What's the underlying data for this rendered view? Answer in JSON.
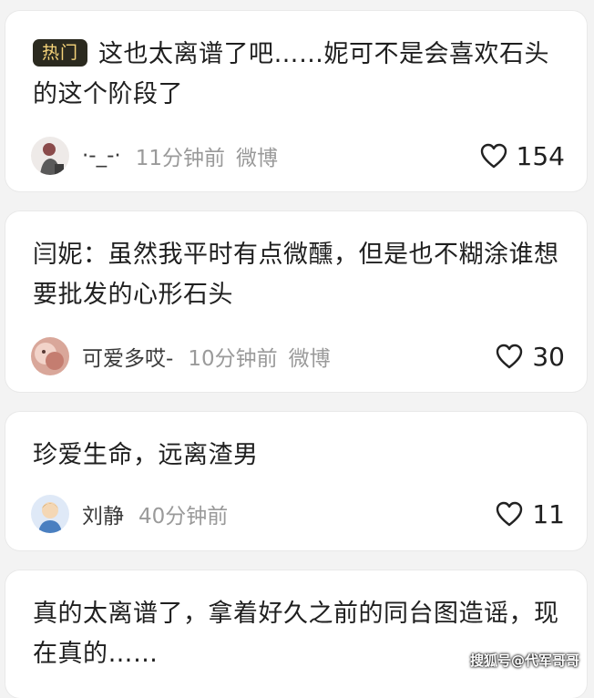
{
  "comments": [
    {
      "badge": "热门",
      "text": "这也太离谱了吧……妮可不是会喜欢石头的这个阶段了",
      "username": "·-_-·",
      "time": "11分钟前",
      "source": "微博",
      "likes": "154"
    },
    {
      "text": "闫妮：虽然我平时有点微醺，但是也不糊涂谁想要批发的心形石头",
      "username": "可爱多哎-",
      "time": "10分钟前",
      "source": "微博",
      "likes": "30"
    },
    {
      "text": "珍爱生命，远离渣男",
      "username": "刘静",
      "time": "40分钟前",
      "likes": "11"
    },
    {
      "text": "真的太离谱了，拿着好久之前的同台图造谣，现在真的……"
    }
  ],
  "watermark": "搜狐号@代军哥哥",
  "colors": {
    "badge_bg": "#2b2a1f",
    "badge_text": "#f6d47a",
    "meta_gray": "#9a9a9a"
  }
}
